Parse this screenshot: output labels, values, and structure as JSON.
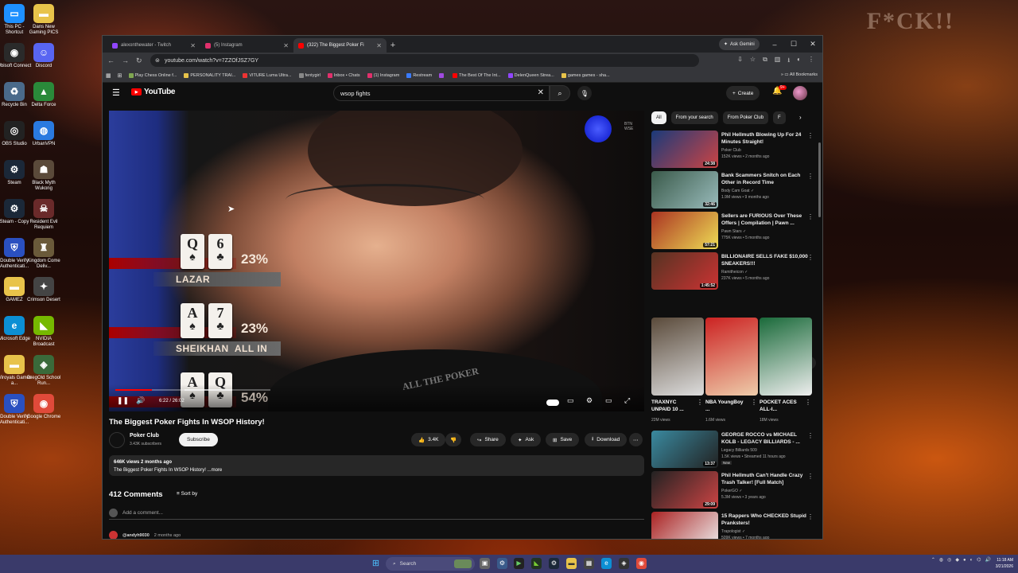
{
  "desktop": {
    "wall_text": "F*CK!!",
    "icons": [
      {
        "label": "This PC - Shortcut",
        "color": "#1e90ff",
        "glyph": "▭"
      },
      {
        "label": "Dans New Gaming PICS",
        "color": "#e8c34a",
        "glyph": "▬"
      },
      {
        "label": "Ubisoft Connect",
        "color": "#2a2a2a",
        "glyph": "◉"
      },
      {
        "label": "Discord",
        "color": "#5865f2",
        "glyph": "☺"
      },
      {
        "label": "Recycle Bin",
        "color": "#4a6a8a",
        "glyph": "♻"
      },
      {
        "label": "Delta Force",
        "color": "#2a8a3a",
        "glyph": "▲"
      },
      {
        "label": "OBS Studio",
        "color": "#222",
        "glyph": "◎"
      },
      {
        "label": "UrbanVPN",
        "color": "#2a7ae0",
        "glyph": "◍"
      },
      {
        "label": "Steam",
        "color": "#1b2838",
        "glyph": "⚙"
      },
      {
        "label": "Black Myth Wukong",
        "color": "#5a4a3a",
        "glyph": "☗"
      },
      {
        "label": "Steam - Copy",
        "color": "#1b2838",
        "glyph": "⚙"
      },
      {
        "label": "Resident Evil Requiem",
        "color": "#6a2a2a",
        "glyph": "☠"
      },
      {
        "label": "Double Verify Authenticati...",
        "color": "#2a50c0",
        "glyph": "⛨"
      },
      {
        "label": "Kingdom Come Deliv...",
        "color": "#6a5a3a",
        "glyph": "♜"
      },
      {
        "label": "GAMEZ",
        "color": "#e8c34a",
        "glyph": "▬"
      },
      {
        "label": "Crimson Desert",
        "color": "#444",
        "glyph": "✦"
      },
      {
        "label": "Microsoft Edge",
        "color": "#0c8fd4",
        "glyph": "e"
      },
      {
        "label": "NVIDIA Broadcast",
        "color": "#76b900",
        "glyph": "◣"
      },
      {
        "label": "Wiroyals Games a...",
        "color": "#e8c34a",
        "glyph": "▬"
      },
      {
        "label": "GregOld School Run...",
        "color": "#3a6a3a",
        "glyph": "◈"
      },
      {
        "label": "Double Verify Authenticati...",
        "color": "#2a50c0",
        "glyph": "⛨"
      },
      {
        "label": "Google Chrome",
        "color": "#e04a3a",
        "glyph": "◉"
      }
    ]
  },
  "browser": {
    "tabs": [
      {
        "label": "alexonthewater - Twitch",
        "color": "#9146ff",
        "active": false
      },
      {
        "label": "(5) Instagram",
        "color": "#e1306c",
        "active": false
      },
      {
        "label": "(322) The Biggest Poker Fi",
        "color": "#ff0000",
        "active": true
      }
    ],
    "ask_gemini": "Ask Gemini",
    "url": "youtube.com/watch?v=7ZZOfJSZ7GY",
    "bookmarks": [
      {
        "label": "Play Chess Online f...",
        "color": "#7fa650"
      },
      {
        "label": "PERSONALITY TRAI...",
        "color": "#e8c34a"
      },
      {
        "label": "VITURE Luma Ultra...",
        "color": "#e33"
      },
      {
        "label": "fentygirl",
        "color": "#888"
      },
      {
        "label": "Inbox • Chats",
        "color": "#e1306c"
      },
      {
        "label": "(1) Instagram",
        "color": "#e1306c"
      },
      {
        "label": "Restream",
        "color": "#3a7bff"
      },
      {
        "label": "",
        "color": "#a04ae0"
      },
      {
        "label": "The Best Of The Int...",
        "color": "#f00"
      },
      {
        "label": "DelenQueen Strea...",
        "color": "#9146ff"
      },
      {
        "label": "games games - sha...",
        "color": "#e8c34a"
      }
    ],
    "all_bookmarks": "All Bookmarks"
  },
  "youtube": {
    "logo": "YouTube",
    "search_value": "wsop fights",
    "create_label": "Create",
    "notif_count": "9+",
    "video": {
      "watermark": "BTN\nWSE",
      "shirt_text": "ALL THE POKER",
      "hands": [
        {
          "cards": [
            [
              "Q",
              "♠"
            ],
            [
              "6",
              "♣"
            ]
          ],
          "pct": "23%",
          "name": "LAZAR"
        },
        {
          "cards": [
            [
              "A",
              "♠"
            ],
            [
              "7",
              "♣"
            ]
          ],
          "pct": "23%",
          "name": "SHEIKHAN  ALL IN"
        },
        {
          "cards": [
            [
              "A",
              "♠"
            ],
            [
              "Q",
              "♣"
            ]
          ],
          "pct": "54%",
          "name": ""
        }
      ],
      "progress": 0.236,
      "time": "6:22 / 26:02"
    },
    "title": "The Biggest Poker Fights In WSOP History!",
    "channel": {
      "name": "Poker Club",
      "subs": "3.43K subscribers",
      "subscribe": "Subscribe"
    },
    "actions": {
      "likes": "3.4K",
      "share": "Share",
      "ask": "Ask",
      "save": "Save",
      "download": "Download"
    },
    "description": {
      "views": "646K views  2 months ago",
      "text": "The Biggest Poker Fights In WSOP History! ...more"
    },
    "comments": {
      "title": "412 Comments",
      "sort": "Sort by",
      "add": "Add a comment...",
      "first_author": "@andyh9030",
      "first_time": "2 months ago"
    },
    "chips": [
      "All",
      "From your search",
      "From Poker Club",
      "F"
    ],
    "recs_top": [
      {
        "title": "Phil Hellmuth Blowing Up For 24 Minutes Straight!",
        "channel": "Poker Club",
        "meta": "152K views • 2 months ago",
        "dur": "24:38",
        "c1": "#1a3a7a",
        "c2": "#c44",
        "verified": false
      },
      {
        "title": "Bank Scammers Snitch on Each Other in Record Time",
        "channel": "Body Cam Goat",
        "meta": "1.9M views • 9 months ago",
        "dur": "32:46",
        "c1": "#3a5a4a",
        "c2": "#9bb",
        "verified": true
      },
      {
        "title": "Sellers are FURIOUS Over These Offers | Compilation | Pawn ...",
        "channel": "Pawn Stars",
        "meta": "775K views • 5 months ago",
        "dur": "57:21",
        "c1": "#aa3322",
        "c2": "#eedd55",
        "verified": true
      },
      {
        "title": "BILLIONAIRE SELLS FAKE $10,000 SNEAKERS!!!",
        "channel": "Ramitheicon",
        "meta": "237K views • 5 months ago",
        "dur": "1:45:52",
        "c1": "#553322",
        "c2": "#cc3333",
        "verified": true
      }
    ],
    "shorts": [
      {
        "title": "TRAXNYC UNPAID 10 ...",
        "views": "22M views",
        "c1": "#5a4a3a",
        "c2": "#ddd"
      },
      {
        "title": "NBA YoungBoy ...",
        "views": "1.6M views",
        "c1": "#cc2222",
        "c2": "#eeccaa"
      },
      {
        "title": "POCKET ACES ALL-I...",
        "views": "18M views",
        "c1": "#1a6a3a",
        "c2": "#eee"
      }
    ],
    "recs_bottom": [
      {
        "title": "GEORGE ROCCO vs MICHAEL KOLB - LEGACY BILLIARDS - ...",
        "channel": "Legacy Billiards 509",
        "meta": "1.5K views • Streamed 11 hours ago",
        "dur": "13:37",
        "c1": "#3a8aa0",
        "c2": "#222",
        "verified": false,
        "new": "New"
      },
      {
        "title": "Phil Hellmuth Can't Handle Crazy Trash Talker! [Full Match]",
        "channel": "PokerGO",
        "meta": "5.3M views • 3 years ago",
        "dur": "29:09",
        "c1": "#222",
        "c2": "#cc4444",
        "verified": true,
        "new": ""
      },
      {
        "title": "15 Rappers Who CHECKED Stupid Pranksters!",
        "channel": "Trapologist",
        "meta": "509K views • 7 months ago",
        "dur": "26:41",
        "c1": "#aa2222",
        "c2": "#eeeeee",
        "verified": true,
        "new": ""
      }
    ]
  },
  "taskbar": {
    "search": "Search",
    "time": "11:18 AM",
    "date": "3/21/2026"
  }
}
